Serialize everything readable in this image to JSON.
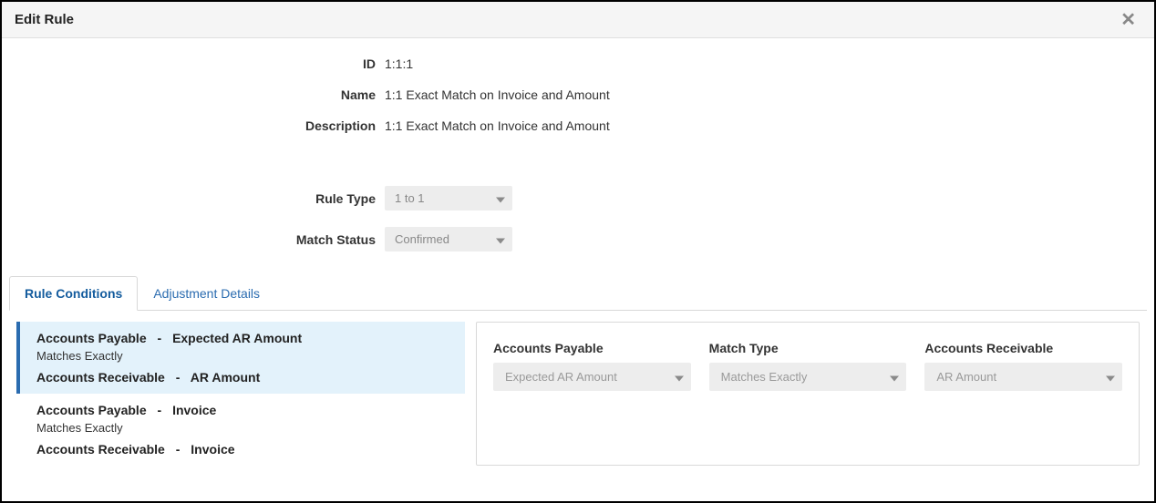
{
  "modal": {
    "title": "Edit Rule"
  },
  "fields": {
    "id_label": "ID",
    "id_value": "1:1:1",
    "name_label": "Name",
    "name_value": "1:1 Exact Match on Invoice and Amount",
    "desc_label": "Description",
    "desc_value": "1:1 Exact Match on Invoice and Amount",
    "ruletype_label": "Rule Type",
    "ruletype_value": "1 to 1",
    "matchstatus_label": "Match Status",
    "matchstatus_value": "Confirmed"
  },
  "tabs": [
    {
      "label": "Rule Conditions"
    },
    {
      "label": "Adjustment Details"
    }
  ],
  "conditions": [
    {
      "source_a": "Accounts Payable",
      "field_a": "Expected AR Amount",
      "match": "Matches Exactly",
      "source_b": "Accounts Receivable",
      "field_b": "AR Amount"
    },
    {
      "source_a": "Accounts Payable",
      "field_a": "Invoice",
      "match": "Matches Exactly",
      "source_b": "Accounts Receivable",
      "field_b": "Invoice"
    }
  ],
  "detail": {
    "col1_label": "Accounts Payable",
    "col1_value": "Expected AR Amount",
    "col2_label": "Match Type",
    "col2_value": "Matches Exactly",
    "col3_label": "Accounts Receivable",
    "col3_value": "AR Amount"
  }
}
